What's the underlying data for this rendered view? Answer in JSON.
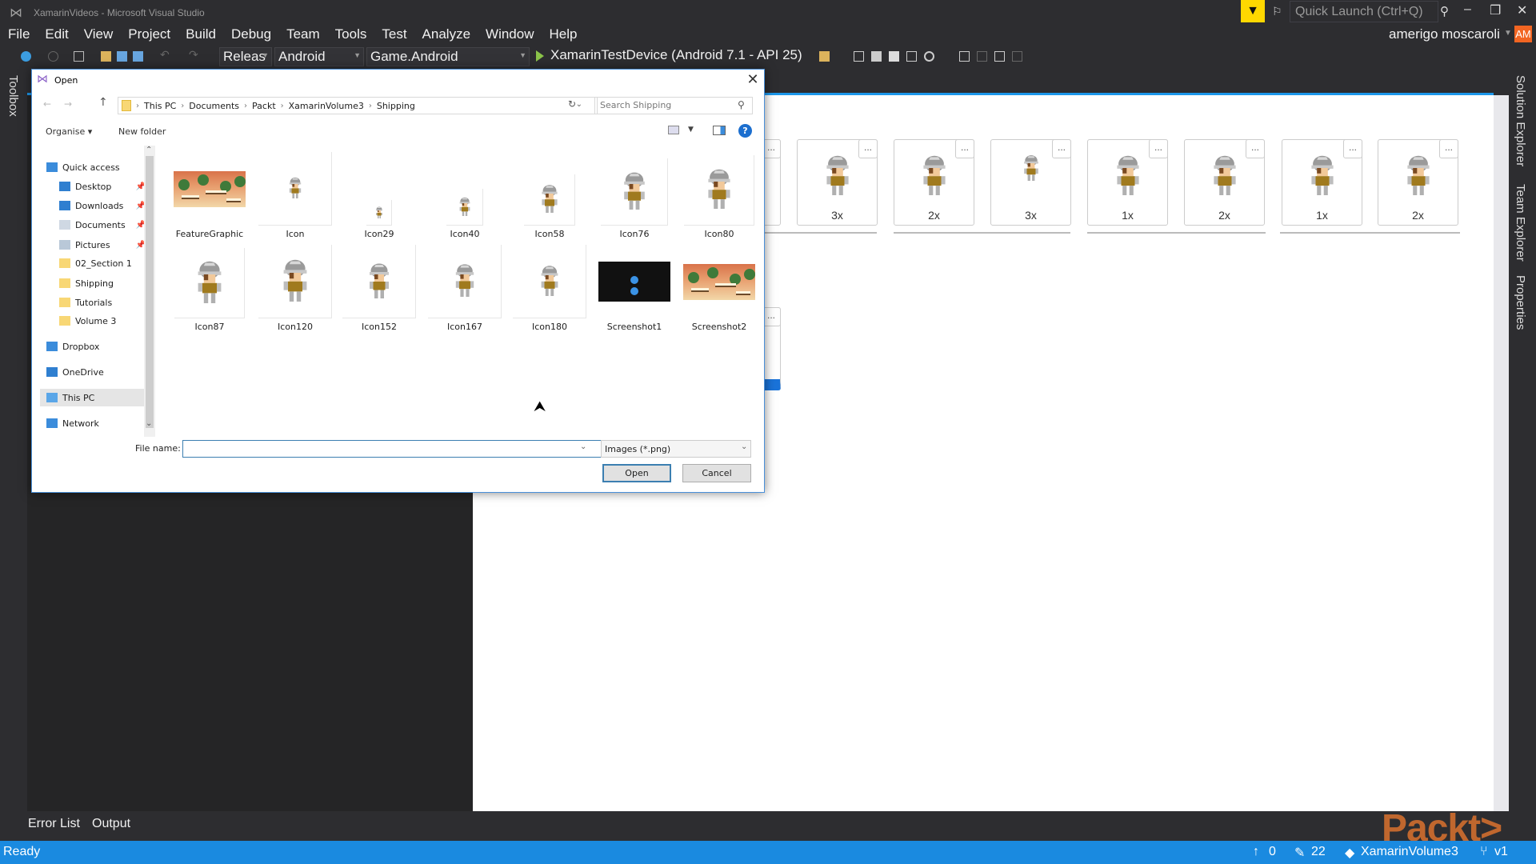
{
  "window": {
    "title": "XamarinVideos - Microsoft Visual Studio",
    "quick_launch_placeholder": "Quick Launch (Ctrl+Q)",
    "user": "amerigo moscaroli",
    "avatar": "AM"
  },
  "menu": [
    "File",
    "Edit",
    "View",
    "Project",
    "Build",
    "Debug",
    "Team",
    "Tools",
    "Test",
    "Analyze",
    "Window",
    "Help"
  ],
  "toolbar": {
    "configuration": "Releas",
    "platform": "Android",
    "startup_project": "Game.Android",
    "run_target": "XamarinTestDevice (Android 7.1 - API 25)"
  },
  "side_panels": {
    "left": "Toolbox",
    "right": [
      "Solution Explorer",
      "Team Explorer",
      "Properties"
    ]
  },
  "asset_catalog": {
    "scales": [
      "3x",
      "2x",
      "3x",
      "1x",
      "2x",
      "1x",
      "2x"
    ],
    "more_label": "..."
  },
  "bottom_tabs": [
    "Error List",
    "Output"
  ],
  "status_bar": {
    "text": "Ready",
    "pending": "0",
    "changes": "22",
    "repo": "XamarinVolume3",
    "branch": "v1"
  },
  "logo": "Packt>",
  "dialog": {
    "title": "Open",
    "breadcrumb": [
      "This PC",
      "Documents",
      "Packt",
      "XamarinVolume3",
      "Shipping"
    ],
    "search_placeholder": "Search Shipping",
    "organise": "Organise ▾",
    "new_folder": "New folder",
    "nav": [
      {
        "label": "Quick access",
        "pinned": false
      },
      {
        "label": "Desktop",
        "pinned": true
      },
      {
        "label": "Downloads",
        "pinned": true
      },
      {
        "label": "Documents",
        "pinned": true
      },
      {
        "label": "Pictures",
        "pinned": true
      },
      {
        "label": "02_Section 1",
        "pinned": false
      },
      {
        "label": "Shipping",
        "pinned": false
      },
      {
        "label": "Tutorials",
        "pinned": false
      },
      {
        "label": "Volume 3",
        "pinned": false
      },
      {
        "label": "Dropbox",
        "pinned": false
      },
      {
        "label": "OneDrive",
        "pinned": false
      },
      {
        "label": "This PC",
        "pinned": false,
        "selected": true
      },
      {
        "label": "Network",
        "pinned": false
      }
    ],
    "files": [
      "FeatureGraphic",
      "Icon",
      "Icon29",
      "Icon40",
      "Icon58",
      "Icon76",
      "Icon80",
      "Icon87",
      "Icon120",
      "Icon152",
      "Icon167",
      "Icon180",
      "Screenshot1",
      "Screenshot2"
    ],
    "file_name_label": "File name:",
    "file_name_value": "",
    "filter": "Images (*.png)",
    "open_label": "Open",
    "cancel_label": "Cancel"
  }
}
